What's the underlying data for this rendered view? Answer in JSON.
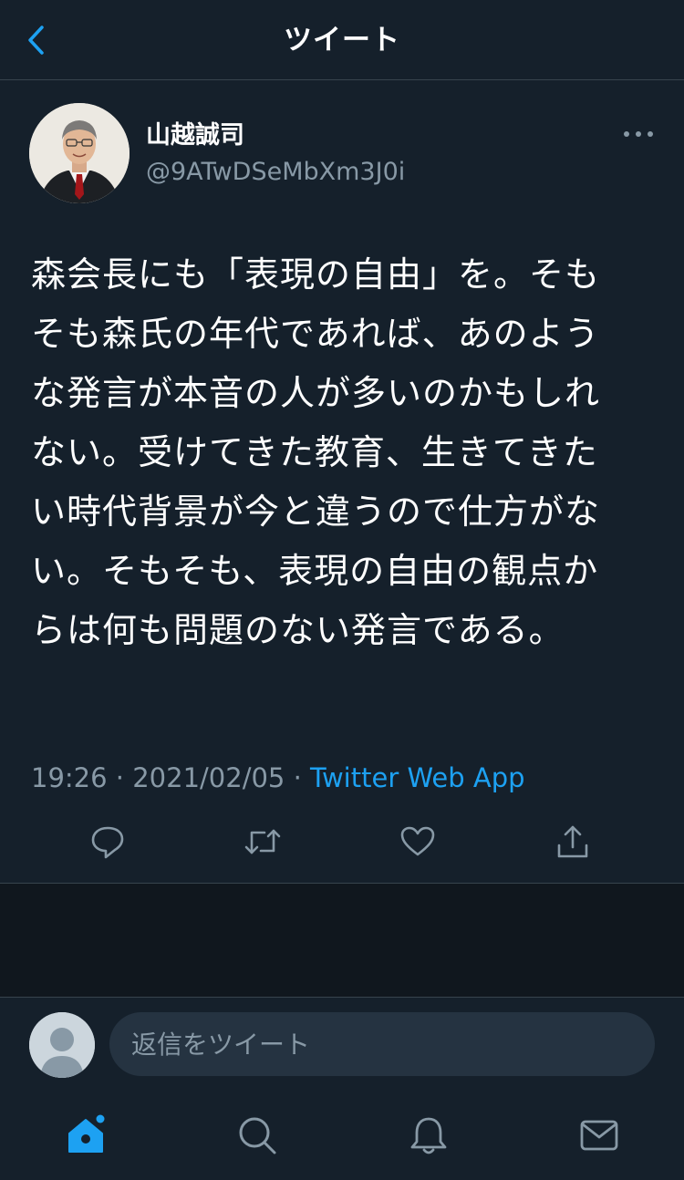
{
  "header": {
    "title": "ツイート"
  },
  "tweet": {
    "display_name": "山越誠司",
    "handle": "@9ATwDSeMbXm3J0i",
    "text": "森会長にも「表現の自由」を。そもそも森氏の年代であれば、あのような発言が本音の人が多いのかもしれない。受けてきた教育、生きてきたい時代背景が今と違うので仕方がない。そもそも、表現の自由の観点からは何も問題のない発言である。",
    "time": "19:26",
    "date": "2021/02/05",
    "separator": "·",
    "source": "Twitter Web App"
  },
  "reply": {
    "placeholder": "返信をツイート"
  },
  "nav": {
    "items": [
      "home-icon",
      "search-icon",
      "bell-icon",
      "mail-icon"
    ]
  },
  "colors": {
    "background": "#15202b",
    "accent": "#1da1f2",
    "muted": "#8899a6",
    "border": "#38444d"
  }
}
